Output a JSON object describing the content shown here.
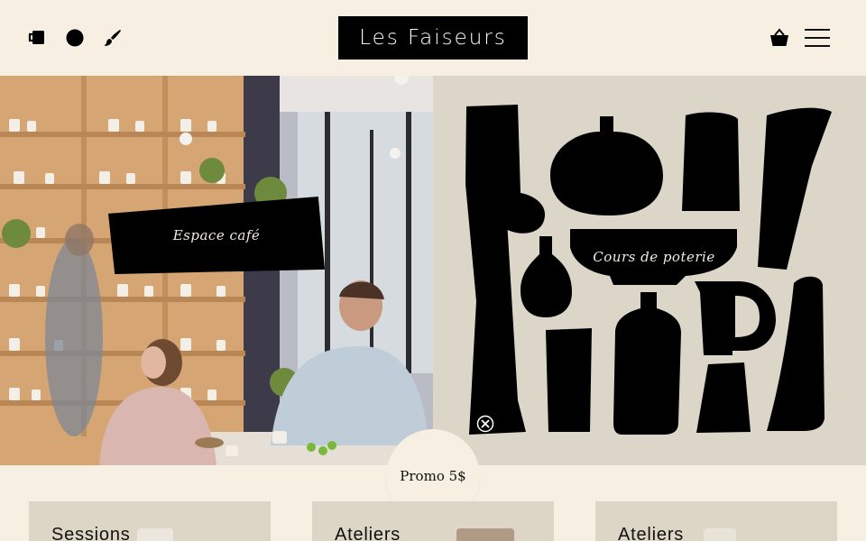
{
  "header": {
    "logo_text": "Les Faiseurs",
    "left_icons": [
      "mug-icon",
      "circle-icon",
      "brush-icon"
    ],
    "cart_icon": "basket-icon",
    "menu_icon": "hamburger-menu-icon"
  },
  "hero": {
    "left": {
      "label": "Espace café",
      "image": "café interior photo"
    },
    "right": {
      "label": "Cours de poterie",
      "image": "pottery silhouettes illustration"
    }
  },
  "promo": {
    "label": "Promo 5$"
  },
  "cards": [
    {
      "title": "Sessions"
    },
    {
      "title": "Ateliers"
    },
    {
      "title": "Ateliers"
    }
  ],
  "colors": {
    "background": "#f6efe2",
    "black": "#000000",
    "pottery_bg": "#dcd6c8",
    "card_bg": "#ddd6c7"
  }
}
